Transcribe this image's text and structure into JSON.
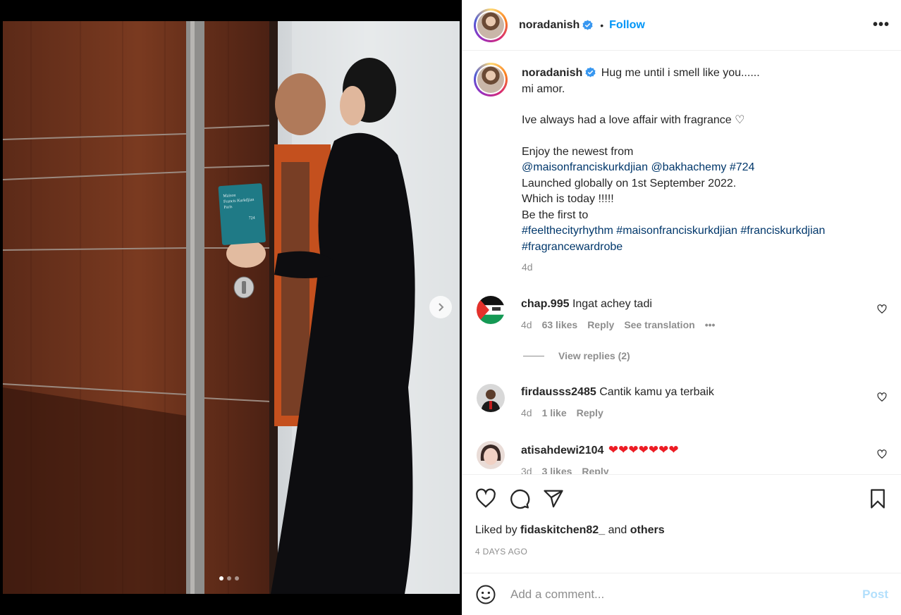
{
  "post": {
    "username": "noradanish",
    "follow_label": "Follow",
    "separator": "•",
    "more_label": "•••"
  },
  "caption": {
    "username": "noradanish",
    "lines": {
      "l1": "Hug me until i smell like you......",
      "l2": "mi amor.",
      "l3": "Ive always had a love affair with fragrance ♡",
      "l4": "Enjoy the newest from",
      "l5a": "@maisonfranciskurkdjian",
      "l5b": "@bakhachemy",
      "l5c": "#724",
      "l6": "Launched globally on 1st September 2022.",
      "l7": "Which is today !!!!!",
      "l8": "Be the first to",
      "l9a": "#feelthecityrhythm",
      "l9b": "#maisonfranciskurkdjian",
      "l9c": "#franciskurkdjian",
      "l10": "#fragrancewardrobe"
    },
    "time": "4d"
  },
  "comments": [
    {
      "username": "chap.995",
      "text": "Ingat achey tadi",
      "time": "4d",
      "likes": "63 likes",
      "reply": "Reply",
      "translate": "See translation",
      "more": "•••"
    },
    {
      "username": "firdausss2485",
      "text": "Cantik kamu ya terbaik",
      "time": "4d",
      "likes": "1 like",
      "reply": "Reply"
    },
    {
      "username": "atisahdewi2104",
      "text": "❤❤❤❤❤❤❤",
      "time": "3d",
      "likes": "3 likes",
      "reply": "Reply"
    }
  ],
  "view_replies": "View replies (2)",
  "liked_by": {
    "prefix": "Liked by",
    "user": "fidaskitchen82_",
    "and": "and",
    "others": "others"
  },
  "date": "4 DAYS AGO",
  "add_comment": {
    "placeholder": "Add a comment...",
    "post_label": "Post"
  },
  "carousel": {
    "current": 1,
    "total": 3
  },
  "colors": {
    "accent": "#0095f6",
    "link": "#00376b",
    "muted": "#8e8e8e",
    "post_disabled": "#b2dffc"
  }
}
